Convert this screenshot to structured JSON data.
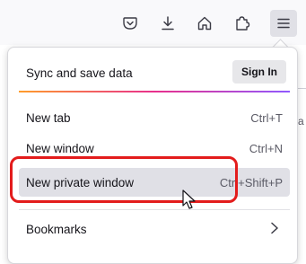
{
  "toolbar": {
    "buttons": [
      {
        "name": "pocket-icon",
        "active": false
      },
      {
        "name": "download-icon",
        "active": false
      },
      {
        "name": "home-icon",
        "active": false
      },
      {
        "name": "extensions-icon",
        "active": false
      },
      {
        "name": "hamburger-menu-icon",
        "active": true
      }
    ]
  },
  "menu": {
    "sync": {
      "label": "Sync and save data",
      "button": "Sign In"
    },
    "items": [
      {
        "label": "New tab",
        "shortcut": "Ctrl+T"
      },
      {
        "label": "New window",
        "shortcut": "Ctrl+N"
      },
      {
        "label": "New private window",
        "shortcut": "Ctrl+Shift+P"
      },
      {
        "label": "Bookmarks",
        "submenu_icon": "chevron-right-icon"
      }
    ],
    "highlighted_item": "New private window"
  },
  "colors": {
    "highlight_border": "#e31c1c",
    "accent_gradient": [
      "#ff9d2b",
      "#e8308c",
      "#9059ff"
    ],
    "hover_bg": "#e0e0e6"
  }
}
